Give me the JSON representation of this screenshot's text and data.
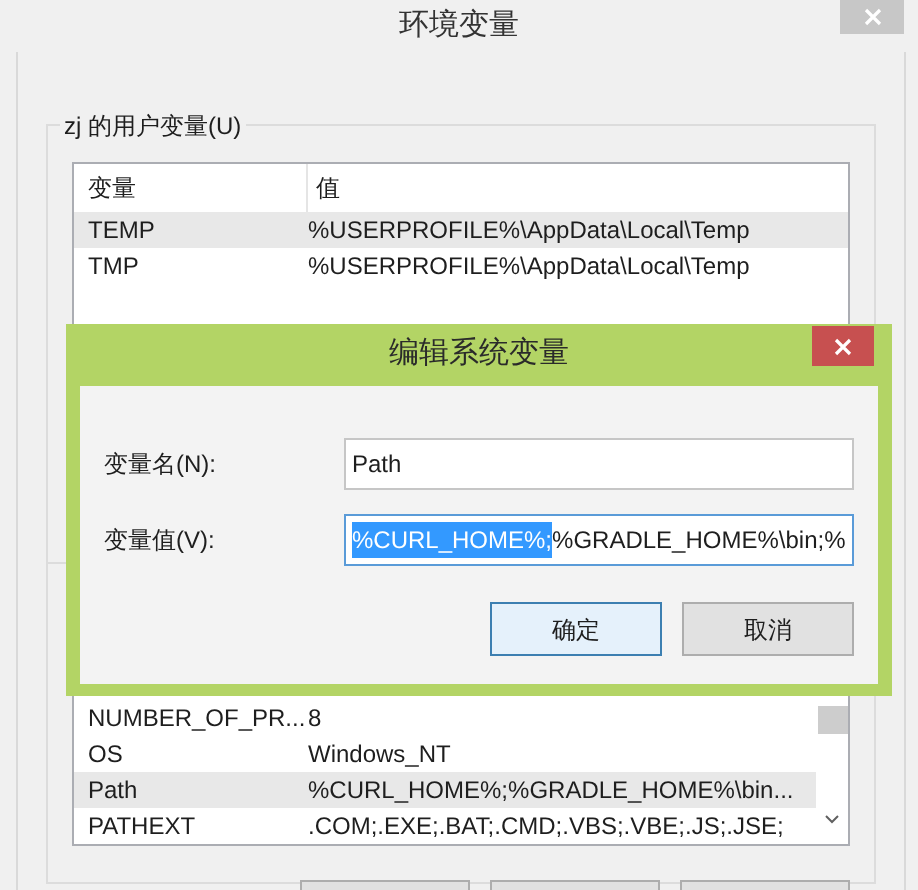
{
  "window": {
    "title": "环境变量"
  },
  "user_vars": {
    "label": "zj 的用户变量(U)",
    "columns": [
      "变量",
      "值"
    ],
    "rows": [
      {
        "name": "TEMP",
        "value": "%USERPROFILE%\\AppData\\Local\\Temp",
        "selected": true
      },
      {
        "name": "TMP",
        "value": "%USERPROFILE%\\AppData\\Local\\Temp",
        "selected": false
      }
    ]
  },
  "system_vars": {
    "rows": [
      {
        "name": "NUMBER_OF_PR...",
        "value": "8",
        "selected": false
      },
      {
        "name": "OS",
        "value": "Windows_NT",
        "selected": false
      },
      {
        "name": "Path",
        "value": "%CURL_HOME%;%GRADLE_HOME%\\bin...",
        "selected": true
      },
      {
        "name": "PATHEXT",
        "value": ".COM;.EXE;.BAT;.CMD;.VBS;.VBE;.JS;.JSE;",
        "selected": false
      }
    ]
  },
  "edit_dialog": {
    "title": "编辑系统变量",
    "fields": [
      {
        "label": "变量名(N):",
        "value": "Path"
      },
      {
        "label": "变量值(V):",
        "selected_part": "%CURL_HOME%;",
        "value": "%GRADLE_HOME%\\bin;%"
      }
    ],
    "buttons": [
      {
        "label": "确定",
        "focused": true
      },
      {
        "label": "取消",
        "focused": false
      }
    ]
  }
}
